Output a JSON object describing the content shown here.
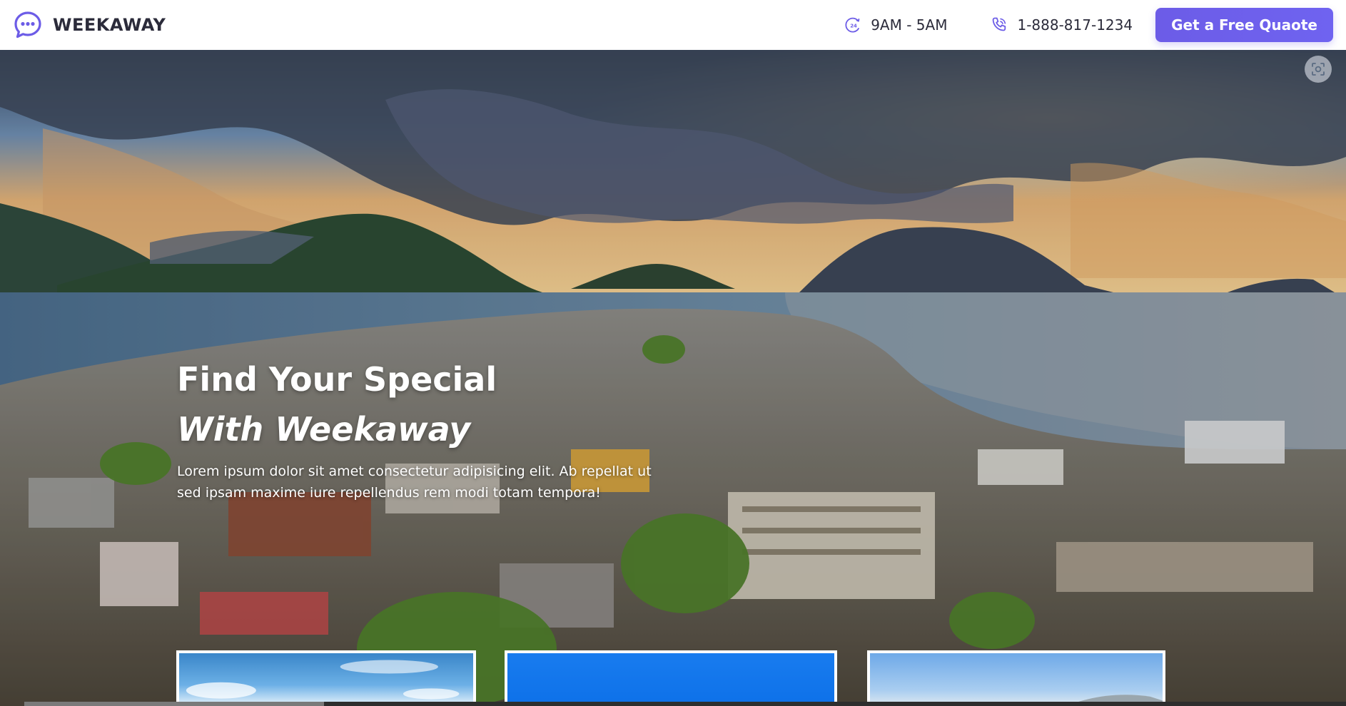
{
  "header": {
    "brand": {
      "name": "WEEKAWAY",
      "icon": "chat-bubble-icon"
    },
    "hours": {
      "text": "9AM - 5AM",
      "icon": "clock-24-icon"
    },
    "phone": {
      "text": "1-888-817-1234",
      "icon": "phone-icon"
    },
    "cta_label": "Get a Free Quaote"
  },
  "hero": {
    "title_line_1": "Find Your Special",
    "title_line_2": "With Weekaway",
    "description_line_1": "Lorem ipsum dolor sit amet consectetur adipisicing elit. Ab repellat ut",
    "description_line_2": "sed ipsam maxime iure repellendus rem modi totam tempora!",
    "scan_icon": "scan-icon"
  },
  "cards": [
    {
      "icon": "beach-photo-icon"
    },
    {
      "icon": "sky-photo-icon"
    },
    {
      "icon": "mountain-photo-icon"
    }
  ],
  "colors": {
    "accent": "#6c5ce7",
    "brand_text": "#2b2b3a",
    "hero_text": "#ffffff"
  }
}
